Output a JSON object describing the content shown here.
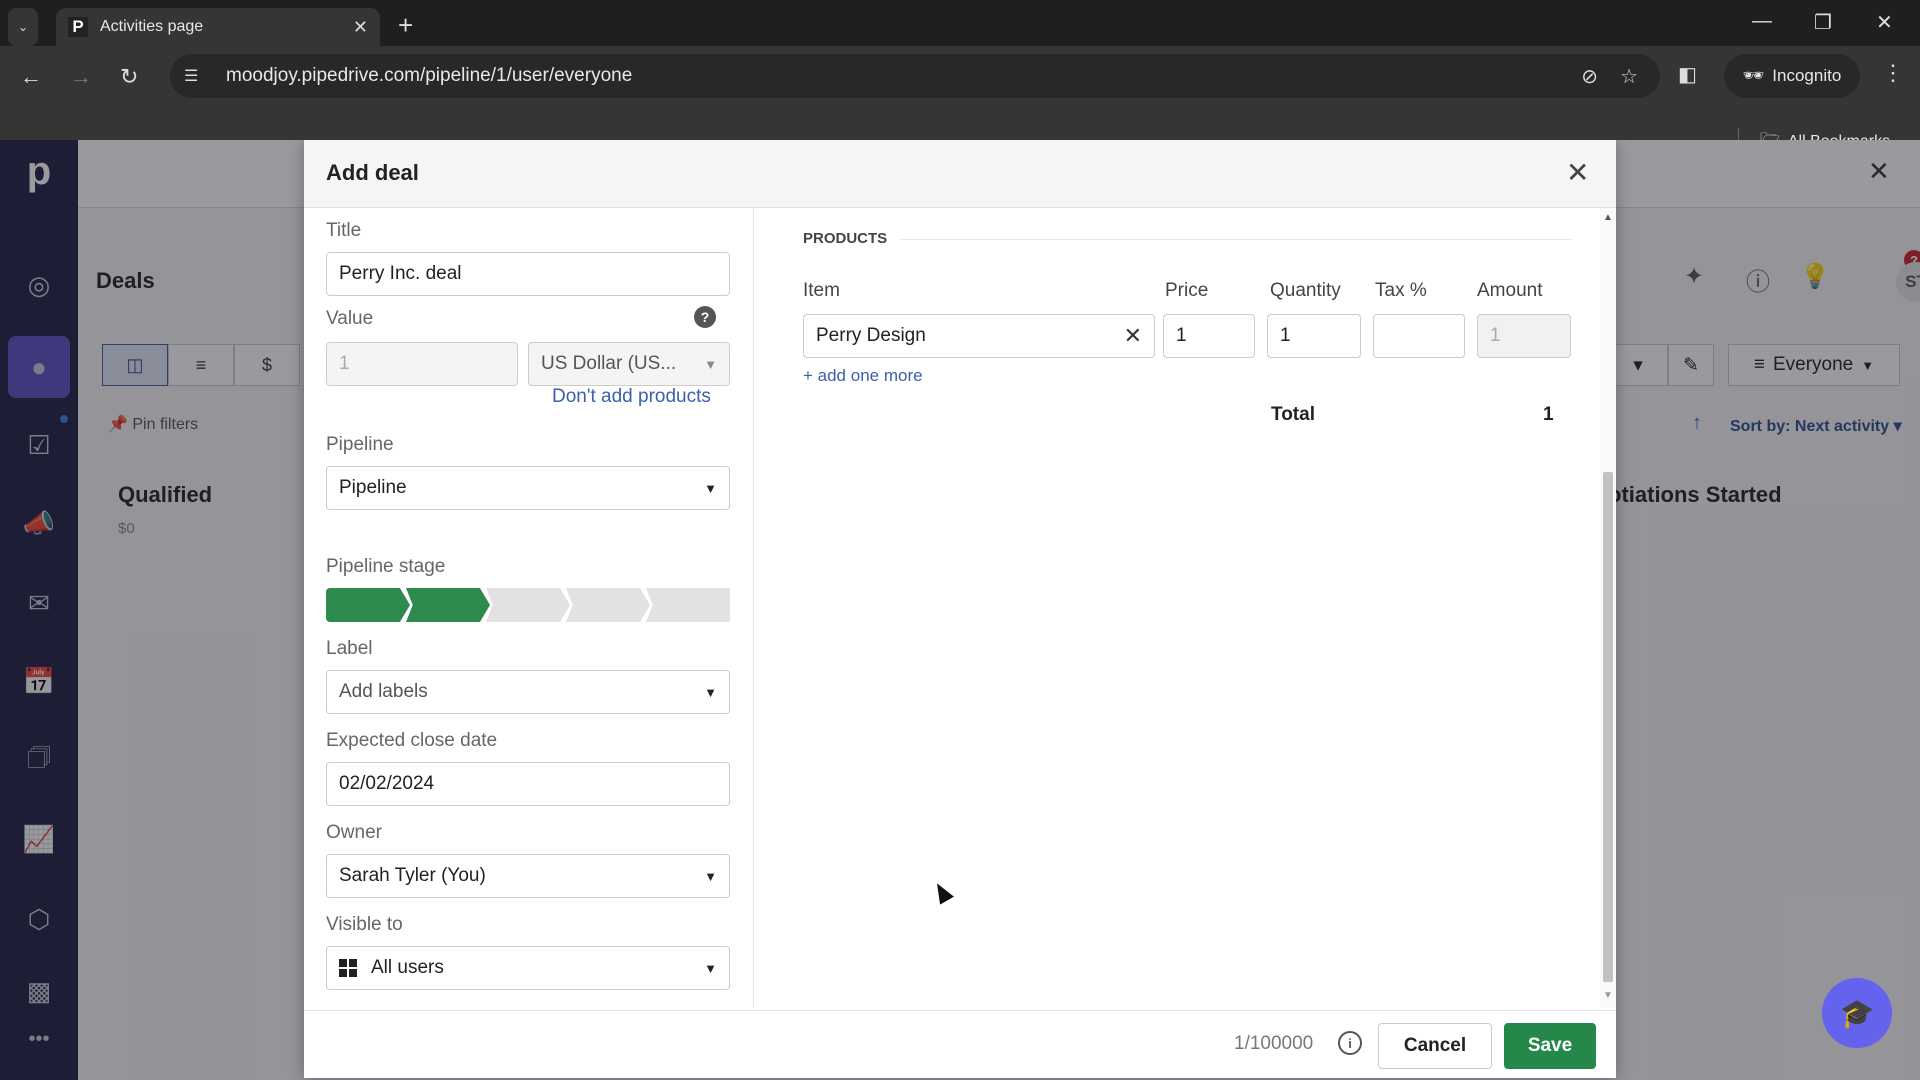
{
  "browser": {
    "tab_title": "Activities page",
    "tab_favicon": "P",
    "url": "moodjoy.pipedrive.com/pipeline/1/user/everyone",
    "incognito_label": "Incognito",
    "bookmarks_label": "All Bookmarks"
  },
  "sidebar": {
    "logo": "p",
    "items": [
      {
        "name": "leads",
        "icon": "target-icon"
      },
      {
        "name": "deals",
        "icon": "dollar-icon",
        "active": true
      },
      {
        "name": "activities",
        "icon": "clipboard-check-icon"
      },
      {
        "name": "campaigns",
        "icon": "megaphone-icon"
      },
      {
        "name": "mail",
        "icon": "mail-icon"
      },
      {
        "name": "calendar",
        "icon": "calendar-icon"
      },
      {
        "name": "contacts",
        "icon": "contact-card-icon"
      },
      {
        "name": "insights",
        "icon": "chart-icon"
      },
      {
        "name": "products",
        "icon": "box-icon"
      },
      {
        "name": "marketplace",
        "icon": "store-icon"
      },
      {
        "name": "more",
        "icon": "more-icon"
      }
    ]
  },
  "background": {
    "page_title": "Deals",
    "pin_filters": "Pin filters",
    "columns": [
      {
        "title": "Qualified",
        "amount": "$0"
      },
      {
        "title": "otiations Started"
      }
    ],
    "filter_label": "Everyone",
    "sort_label": "Sort by: Next activity",
    "avatar_initials": "ST",
    "notification_badge": "?"
  },
  "modal": {
    "title": "Add deal",
    "fields": {
      "title_label": "Title",
      "title_value": "Perry Inc. deal",
      "value_label": "Value",
      "value_value": "1",
      "currency": "US Dollar (US...",
      "dont_add_products": "Don't add products",
      "pipeline_label": "Pipeline",
      "pipeline_value": "Pipeline",
      "stage_label": "Pipeline stage",
      "stage_total": 5,
      "stage_completed": 2,
      "label_label": "Label",
      "label_placeholder": "Add labels",
      "close_date_label": "Expected close date",
      "close_date_value": "02/02/2024",
      "owner_label": "Owner",
      "owner_value": "Sarah Tyler (You)",
      "visible_label": "Visible to",
      "visible_value": "All users"
    },
    "products": {
      "section_title": "PRODUCTS",
      "headers": [
        "Item",
        "Price",
        "Quantity",
        "Tax %",
        "Amount"
      ],
      "rows": [
        {
          "item": "Perry Design",
          "price": "1",
          "quantity": "1",
          "tax": "",
          "amount": "1"
        }
      ],
      "add_more": "+ add one more",
      "total_label": "Total",
      "total_value": "1"
    },
    "footer": {
      "counter": "1/100000",
      "cancel": "Cancel",
      "save": "Save"
    }
  },
  "colors": {
    "accent_green": "#25884a",
    "sidebar_bg": "#1c1d42",
    "sidebar_active": "#5a4dc4",
    "link_blue": "#3b5faa"
  }
}
